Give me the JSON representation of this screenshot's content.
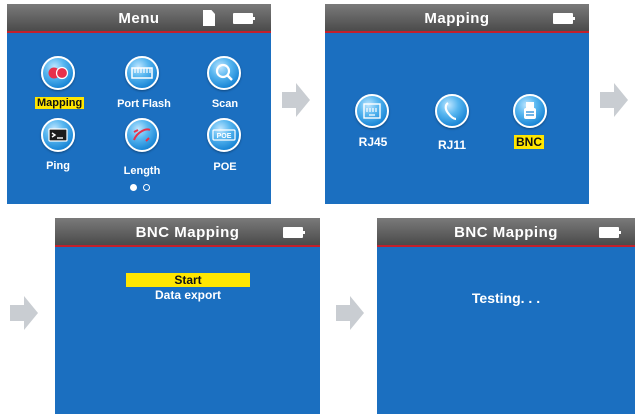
{
  "screen1": {
    "title": "Menu",
    "icons": {
      "sd": "sd-card-icon",
      "battery": "battery-icon"
    },
    "items": [
      {
        "label": "Mapping",
        "icon": "mapping-icon",
        "selected": true
      },
      {
        "label": "Port Flash",
        "icon": "port-flash-icon",
        "selected": false
      },
      {
        "label": "Scan",
        "icon": "scan-icon",
        "selected": false
      },
      {
        "label": "Ping",
        "icon": "ping-icon",
        "selected": false
      },
      {
        "label": "Length",
        "icon": "length-icon",
        "selected": false
      },
      {
        "label": "POE",
        "icon": "poe-icon",
        "selected": false
      }
    ],
    "page_indicator": {
      "pages": 2,
      "current": 1
    }
  },
  "screen2": {
    "title": "Mapping",
    "icons": {
      "battery": "battery-icon"
    },
    "items": [
      {
        "label": "RJ45",
        "icon": "rj45-icon",
        "selected": false
      },
      {
        "label": "RJ11",
        "icon": "rj11-icon",
        "selected": false
      },
      {
        "label": "BNC",
        "icon": "bnc-icon",
        "selected": true
      }
    ]
  },
  "screen3": {
    "title": "BNC Mapping",
    "icons": {
      "battery": "battery-icon"
    },
    "items": [
      {
        "label": "Start",
        "selected": true
      },
      {
        "label": "Data export",
        "selected": false
      }
    ]
  },
  "screen4": {
    "title": "BNC Mapping",
    "icons": {
      "battery": "battery-icon"
    },
    "status": "Testing. . ."
  },
  "colors": {
    "screen_bg": "#1b6fc0",
    "titlebar": "#5a5a5a",
    "titlebar_line": "#c3202c",
    "highlight": "#ffe600",
    "arrow": "#c9cdd2"
  },
  "arrows": [
    "flow-arrow-icon",
    "flow-arrow-icon",
    "flow-arrow-icon",
    "flow-arrow-icon"
  ]
}
